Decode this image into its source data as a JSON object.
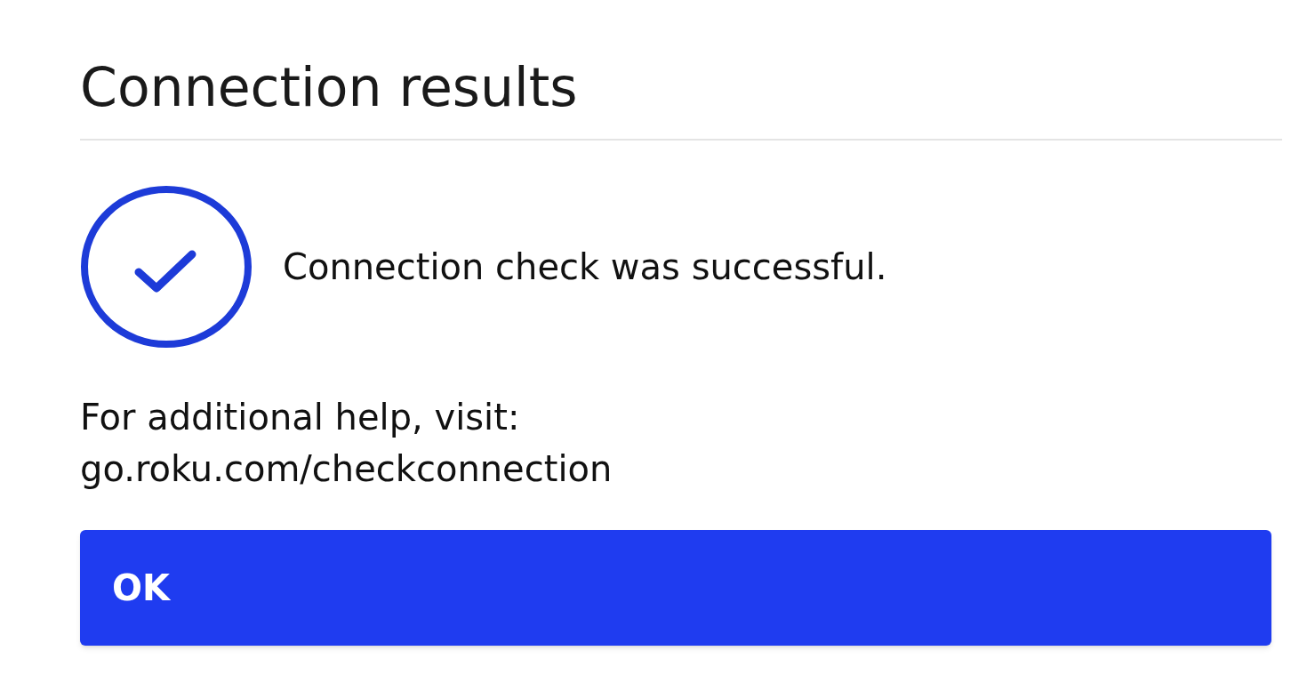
{
  "title": "Connection results",
  "result": {
    "kind": "success",
    "message": "Connection check was successful."
  },
  "help": {
    "text": "For additional help, visit:",
    "link": "go.roku.com/checkconnection"
  },
  "button": {
    "label": "OK"
  }
}
